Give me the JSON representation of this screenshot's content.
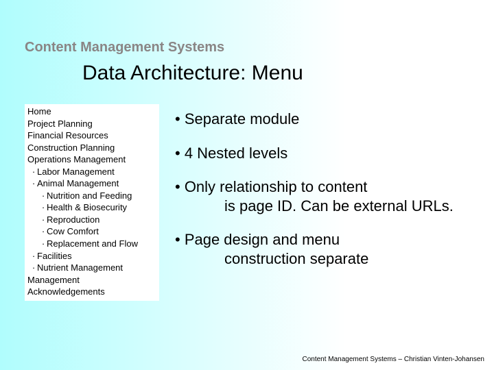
{
  "header": "Content Management Systems",
  "title": "Data Architecture: Menu",
  "menu": {
    "items": [
      {
        "label": "Home",
        "level": 0,
        "dot": false
      },
      {
        "label": "Project Planning",
        "level": 0,
        "dot": false
      },
      {
        "label": "Financial Resources",
        "level": 0,
        "dot": false
      },
      {
        "label": "Construction Planning",
        "level": 0,
        "dot": false
      },
      {
        "label": "Operations Management",
        "level": 0,
        "dot": false
      },
      {
        "label": "Labor Management",
        "level": 1,
        "dot": true
      },
      {
        "label": "Animal Management",
        "level": 1,
        "dot": true
      },
      {
        "label": "Nutrition and Feeding",
        "level": 2,
        "dot": true
      },
      {
        "label": "Health & Biosecurity",
        "level": 2,
        "dot": true
      },
      {
        "label": "Reproduction",
        "level": 2,
        "dot": true
      },
      {
        "label": "Cow Comfort",
        "level": 2,
        "dot": true
      },
      {
        "label": "Replacement and Flow",
        "level": 2,
        "dot": true
      },
      {
        "label": "Facilities",
        "level": 1,
        "dot": true
      },
      {
        "label": "Nutrient Management",
        "level": 1,
        "dot": true
      },
      {
        "label": "Management",
        "level": 0,
        "dot": false
      },
      {
        "label": "Acknowledgements",
        "level": 0,
        "dot": false
      }
    ]
  },
  "bullets": [
    {
      "line1": "• Separate module",
      "line2": ""
    },
    {
      "line1": "• 4 Nested levels",
      "line2": ""
    },
    {
      "line1": "• Only relationship to content",
      "line2": "is page ID. Can be external URLs."
    },
    {
      "line1": "• Page design and menu",
      "line2": "construction separate"
    }
  ],
  "footer": "Content Management Systems – Christian Vinten-Johansen"
}
